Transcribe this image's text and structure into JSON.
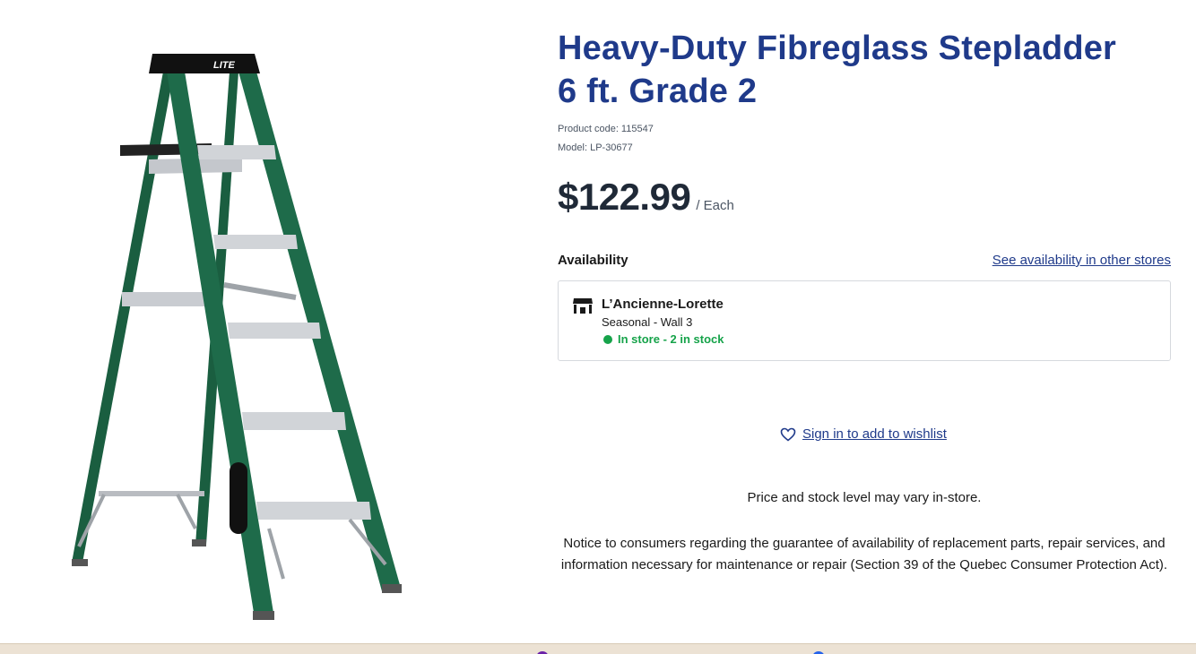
{
  "product": {
    "title_line1": "Heavy-Duty Fibreglass Stepladder",
    "title_line2": "6 ft. Grade 2",
    "code_label": "Product code: 115547",
    "model_label": "Model: LP-30677",
    "price": "$122.99",
    "unit": "/ Each",
    "image_brand": "LITE"
  },
  "availability": {
    "label": "Availability",
    "link": "See availability in other stores",
    "store": {
      "name": "L’Ancienne-Lorette",
      "aisle": "Seasonal - Wall 3",
      "stock": "In store - 2 in stock",
      "icon": "store-icon"
    }
  },
  "wishlist": {
    "label": "Sign in to add to wishlist",
    "icon": "heart-icon"
  },
  "disclaimer": "Price and stock level may vary in-store.",
  "notice": "Notice to consumers regarding the guarantee of availability of replacement parts, repair services, and information necessary for maintenance or repair (Section 39 of the Quebec Consumer Protection Act).",
  "colors": {
    "title": "#1f3a8a",
    "link": "#1f3a8a",
    "in_stock": "#16a34a",
    "ladder_green": "#1e6b4a"
  }
}
